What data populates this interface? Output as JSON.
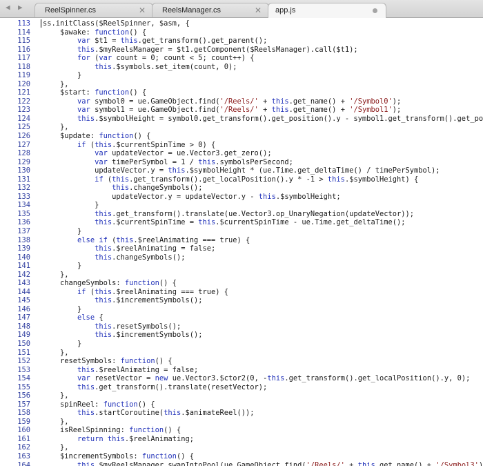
{
  "nav": {
    "back_icon": "◀",
    "forward_icon": "▶"
  },
  "tabs": [
    {
      "label": "ReelSpinner.cs",
      "active": false,
      "close_glyph": "✕"
    },
    {
      "label": "ReelsManager.cs",
      "active": false,
      "close_glyph": "✕"
    },
    {
      "label": "app.js",
      "active": true,
      "close_glyph": ""
    }
  ],
  "editor": {
    "current_line": 113,
    "colors": {
      "line_number": "#2f3ea0",
      "keyword": "#1e2fb8",
      "string": "#8a1a1a",
      "text": "#1a1a1a"
    },
    "lines": [
      {
        "n": "113",
        "t": "ss.initClass($ReelSpinner, $asm, {"
      },
      {
        "n": "114",
        "t": "    $awake: function() {"
      },
      {
        "n": "115",
        "t": "        var $t1 = this.get_transform().get_parent();"
      },
      {
        "n": "116",
        "t": "        this.$myReelsManager = $t1.getComponent($ReelsManager).call($t1);"
      },
      {
        "n": "117",
        "t": "        for (var count = 0; count < 5; count++) {"
      },
      {
        "n": "118",
        "t": "            this.$symbols.set_item(count, 0);"
      },
      {
        "n": "119",
        "t": "        }"
      },
      {
        "n": "120",
        "t": "    },"
      },
      {
        "n": "121",
        "t": "    $start: function() {"
      },
      {
        "n": "122",
        "t": "        var symbol0 = ue.GameObject.find('/Reels/' + this.get_name() + '/Symbol0');"
      },
      {
        "n": "123",
        "t": "        var symbol1 = ue.GameObject.find('/Reels/' + this.get_name() + '/Symbol1');"
      },
      {
        "n": "124",
        "t": "        this.$symbolHeight = symbol0.get_transform().get_position().y - symbol1.get_transform().get_po"
      },
      {
        "n": "125",
        "t": "    },"
      },
      {
        "n": "126",
        "t": "    $update: function() {"
      },
      {
        "n": "127",
        "t": "        if (this.$currentSpinTime > 0) {"
      },
      {
        "n": "128",
        "t": "            var updateVector = ue.Vector3.get_zero();"
      },
      {
        "n": "129",
        "t": "            var timePerSymbol = 1 / this.symbolsPerSecond;"
      },
      {
        "n": "130",
        "t": "            updateVector.y = this.$symbolHeight * (ue.Time.get_deltaTime() / timePerSymbol);"
      },
      {
        "n": "131",
        "t": "            if (this.get_transform().get_localPosition().y * -1 > this.$symbolHeight) {"
      },
      {
        "n": "132",
        "t": "                this.changeSymbols();"
      },
      {
        "n": "133",
        "t": "                updateVector.y = updateVector.y - this.$symbolHeight;"
      },
      {
        "n": "134",
        "t": "            }"
      },
      {
        "n": "135",
        "t": "            this.get_transform().translate(ue.Vector3.op_UnaryNegation(updateVector));"
      },
      {
        "n": "136",
        "t": "            this.$currentSpinTime = this.$currentSpinTime - ue.Time.get_deltaTime();"
      },
      {
        "n": "137",
        "t": "        }"
      },
      {
        "n": "138",
        "t": "        else if (this.$reelAnimating === true) {"
      },
      {
        "n": "139",
        "t": "            this.$reelAnimating = false;"
      },
      {
        "n": "140",
        "t": "            this.changeSymbols();"
      },
      {
        "n": "141",
        "t": "        }"
      },
      {
        "n": "142",
        "t": "    },"
      },
      {
        "n": "143",
        "t": "    changeSymbols: function() {"
      },
      {
        "n": "144",
        "t": "        if (this.$reelAnimating === true) {"
      },
      {
        "n": "145",
        "t": "            this.$incrementSymbols();"
      },
      {
        "n": "146",
        "t": "        }"
      },
      {
        "n": "147",
        "t": "        else {"
      },
      {
        "n": "148",
        "t": "            this.resetSymbols();"
      },
      {
        "n": "149",
        "t": "            this.$incrementSymbols();"
      },
      {
        "n": "150",
        "t": "        }"
      },
      {
        "n": "151",
        "t": "    },"
      },
      {
        "n": "152",
        "t": "    resetSymbols: function() {"
      },
      {
        "n": "153",
        "t": "        this.$reelAnimating = false;"
      },
      {
        "n": "154",
        "t": "        var resetVector = new ue.Vector3.$ctor2(0, -this.get_transform().get_localPosition().y, 0);"
      },
      {
        "n": "155",
        "t": "        this.get_transform().translate(resetVector);"
      },
      {
        "n": "156",
        "t": "    },"
      },
      {
        "n": "157",
        "t": "    spinReel: function() {"
      },
      {
        "n": "158",
        "t": "        this.startCoroutine(this.$animateReel());"
      },
      {
        "n": "159",
        "t": "    },"
      },
      {
        "n": "160",
        "t": "    isReelSpinning: function() {"
      },
      {
        "n": "161",
        "t": "        return this.$reelAnimating;"
      },
      {
        "n": "162",
        "t": "    },"
      },
      {
        "n": "163",
        "t": "    $incrementSymbols: function() {"
      },
      {
        "n": "164",
        "t": "        this.$myReelsManager.swapIntoPool(ue.GameObject.find('/Reels/' + this.get_name() + '/Symbol3')"
      }
    ]
  }
}
